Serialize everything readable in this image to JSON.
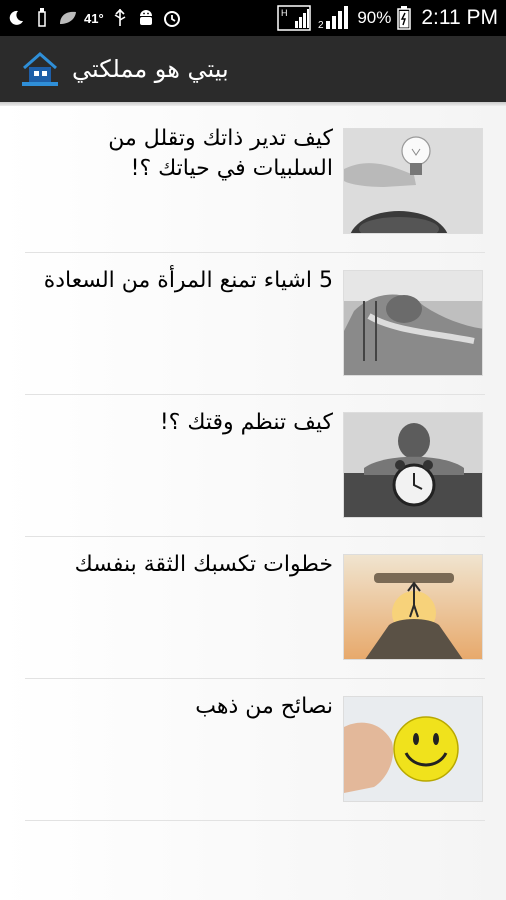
{
  "status_bar": {
    "temperature": "41°",
    "battery_percent": "90%",
    "clock": "2:11 PM",
    "icons": [
      "moon-icon",
      "usb-icon",
      "leaf-icon",
      "usb-debug-icon",
      "android-icon",
      "alarm-icon",
      "signal-h-icon",
      "signal-bars-icon",
      "battery-icon"
    ]
  },
  "app_bar": {
    "title": "بيتي هو مملكتي",
    "logo_icon": "house-logo-icon"
  },
  "articles": [
    {
      "title": "كيف تدير ذاتك وتقلل من السلبيات في حياتك ؟!",
      "thumbnail": "lightbulb-photo"
    },
    {
      "title": "5 اشياء تمنع المرأة من السعادة",
      "thumbnail": "woman-lying-photo"
    },
    {
      "title": "كيف تنظم وقتك ؟!",
      "thumbnail": "man-alarm-clock-photo"
    },
    {
      "title": "خطوات تكسبك الثقة بنفسك",
      "thumbnail": "figure-lifting-log-photo"
    },
    {
      "title": "نصائح من ذهب",
      "thumbnail": "smiley-ball-photo"
    }
  ],
  "colors": {
    "status_bar_bg": "#000000",
    "app_bar_bg": "#2b2b2b",
    "list_bg": "#f7f7f7",
    "divider": "#e2e2e2"
  }
}
